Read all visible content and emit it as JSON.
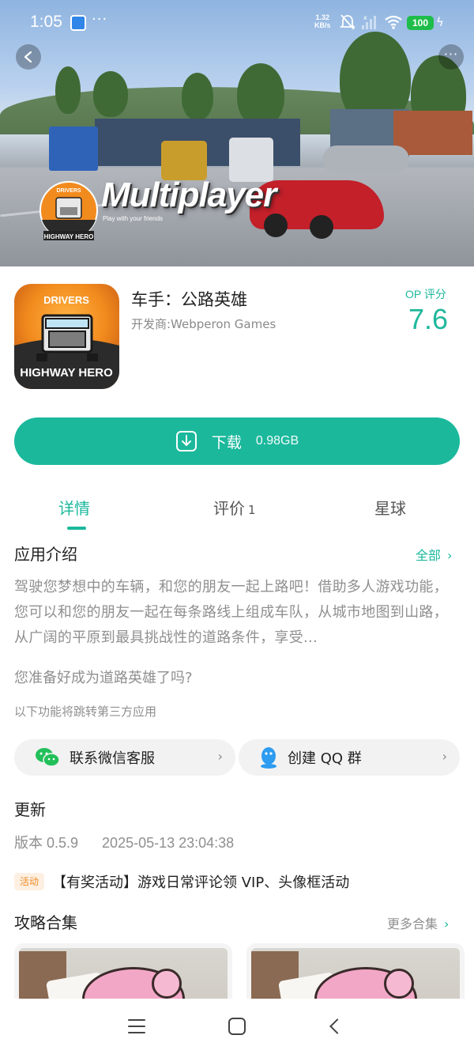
{
  "status_bar": {
    "time": "1:05",
    "dots": "···",
    "net_speed_value": "1.32",
    "net_speed_unit": "KB/s",
    "battery": "100"
  },
  "hero": {
    "title": "Multiplayer",
    "subtitle": "Play with your friends",
    "logo_top": "DRIVERS",
    "logo_bottom": "HIGHWAY HERO"
  },
  "app": {
    "name": "车手：公路英雄",
    "developer": "开发商:Webperon Games",
    "score_label": "OP 评分",
    "score": "7.6",
    "icon_top": "DRIVERS",
    "icon_bottom": "HIGHWAY HERO"
  },
  "download": {
    "label": "下载",
    "size": "0.98GB"
  },
  "tabs": [
    {
      "label": "详情",
      "count": "",
      "active": true
    },
    {
      "label": "评价",
      "count": "1",
      "active": false
    },
    {
      "label": "星球",
      "count": "",
      "active": false
    }
  ],
  "intro": {
    "title": "应用介绍",
    "see_all": "全部",
    "text": "驾驶您梦想中的车辆，和您的朋友一起上路吧！借助多人游戏功能，您可以和您的朋友一起在每条路线上组成车队，从城市地图到山路，从广阔的平原到最具挑战性的道路条件，享受...",
    "question": "您准备好成为道路英雄了吗?",
    "third_party_notice": "以下功能将跳转第三方应用"
  },
  "contacts": {
    "wechat": "联系微信客服",
    "qq": "创建 QQ 群"
  },
  "update": {
    "title": "更新",
    "version": "版本 0.5.9",
    "date": "2025-05-13 23:04:38"
  },
  "activity": {
    "badge": "活动",
    "text": "【有奖活动】游戏日常评论领 VIP、头像框活动"
  },
  "guides": {
    "title": "攻略合集",
    "more": "更多合集"
  },
  "colors": {
    "accent": "#1bb89c",
    "activity": "#f08a24"
  }
}
